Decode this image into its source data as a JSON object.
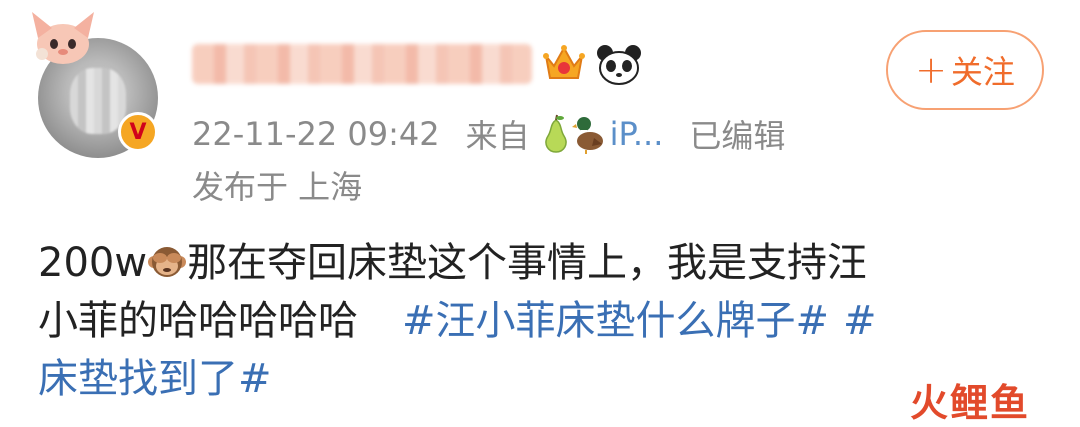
{
  "post": {
    "timestamp": "22-11-22 09:42",
    "source_prefix": "来自",
    "source_device": "iP...",
    "edited": "已编辑",
    "location": "发布于 上海",
    "follow_label": "关注",
    "follow_plus": "+",
    "verified_badge": "V",
    "body_line1_prefix": "200w",
    "body_line1_rest": "那在夺回床垫这个事情上，我是支持汪",
    "body_line2_text": "小菲的哈哈哈哈哈",
    "hashtag1": "#汪小菲床垫什么牌子#",
    "hashtag2_part1": "#",
    "hashtag2_part2": "床垫找到了#"
  },
  "watermark": {
    "c1": "火",
    "c2": "鲤",
    "c3": "鱼"
  },
  "colors": {
    "follow_accent": "#f06c2b",
    "hashtag": "#3a6fb4",
    "meta_gray": "#8a8a8a",
    "watermark": "#e24a2b"
  },
  "icons": {
    "avatar_decoration": "cartoon-fox-headband",
    "username_badges": [
      "crown-icon",
      "panda-icon"
    ],
    "source_icons": [
      "pear-icon",
      "duck-icon"
    ],
    "emoji_in_text": "monkey-see-no-evil-icon"
  }
}
